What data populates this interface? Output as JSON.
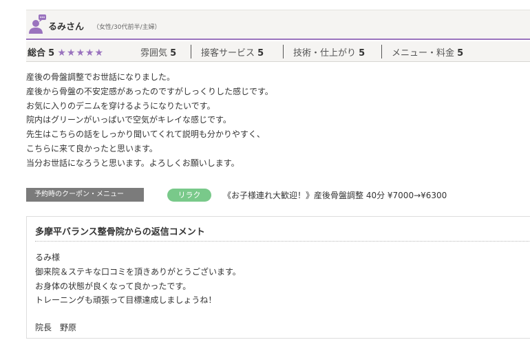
{
  "reviewer": {
    "name": "るみさん",
    "meta": "（女性/30代前半/主婦）"
  },
  "ratings": {
    "overall_label": "総合",
    "overall_value": "5",
    "stars": "★★★★★",
    "star_count": 5,
    "items": [
      {
        "label": "雰囲気",
        "value": "5"
      },
      {
        "label": "接客サービス",
        "value": "5"
      },
      {
        "label": "技術・仕上がり",
        "value": "5"
      },
      {
        "label": "メニュー・料金",
        "value": "5"
      }
    ]
  },
  "review_lines": [
    "産後の骨盤調整でお世話になりました。",
    "産後から骨盤の不安定感があったのですがしっくりした感じです。",
    "お気に入りのデニムを穿けるようになりたいです。",
    "院内はグリーンがいっぱいで空気がキレイな感じです。",
    "先生はこちらの話をしっかり聞いてくれて説明も分かりやすく、",
    "こちらに来て良かったと思います。",
    "当分お世話になろうと思います。よろしくお願いします。"
  ],
  "coupon": {
    "label": "予約時のクーポン・メニュー",
    "badge": "リラク",
    "text": "《お子様連れ大歓迎！》産後骨盤調整 40分 ¥7000→¥6300"
  },
  "reply": {
    "title": "多摩平バランス整骨院からの返信コメント",
    "lines": [
      "るみ様",
      "御来院＆ステキな口コミを頂きありがとうございます。",
      "お身体の状態が良くなって良かったです。",
      "トレーニングも頑張って目標達成しましょうね！"
    ],
    "signature": "院長　野原"
  },
  "colors": {
    "accent": "#9a73be",
    "badge": "#79c98a",
    "coupon_bg": "#7b7b7b",
    "header_bg": "#f5f4f2"
  },
  "icons": {
    "avatar": "user-avatar-icon",
    "speech": "speech-bubble-icon"
  }
}
